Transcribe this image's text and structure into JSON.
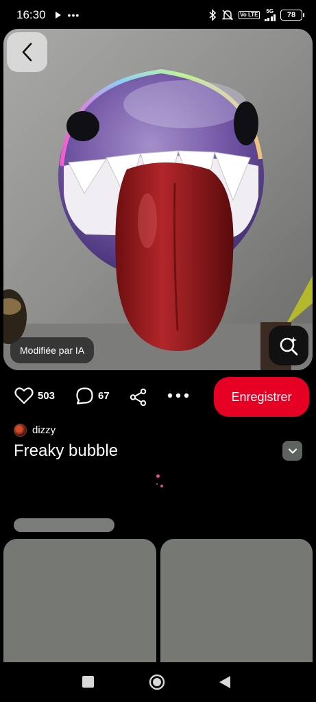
{
  "status_bar": {
    "time": "16:30",
    "battery": "78",
    "network_label": "5G",
    "volte_label": "Vo LTE"
  },
  "pin": {
    "ai_badge": "Modifiée par IA",
    "likes": "503",
    "comments": "67",
    "save_label": "Enregistrer",
    "author": "dizzy",
    "title": "Freaky bubble"
  },
  "colors": {
    "accent": "#e60023",
    "background": "#000000",
    "skeleton": "#767874"
  },
  "icons": {
    "back": "chevron-left-icon",
    "lens": "visual-search-icon",
    "like": "heart-icon",
    "comment": "comment-icon",
    "share": "share-icon",
    "more": "more-icon",
    "expand": "chevron-down-icon"
  }
}
